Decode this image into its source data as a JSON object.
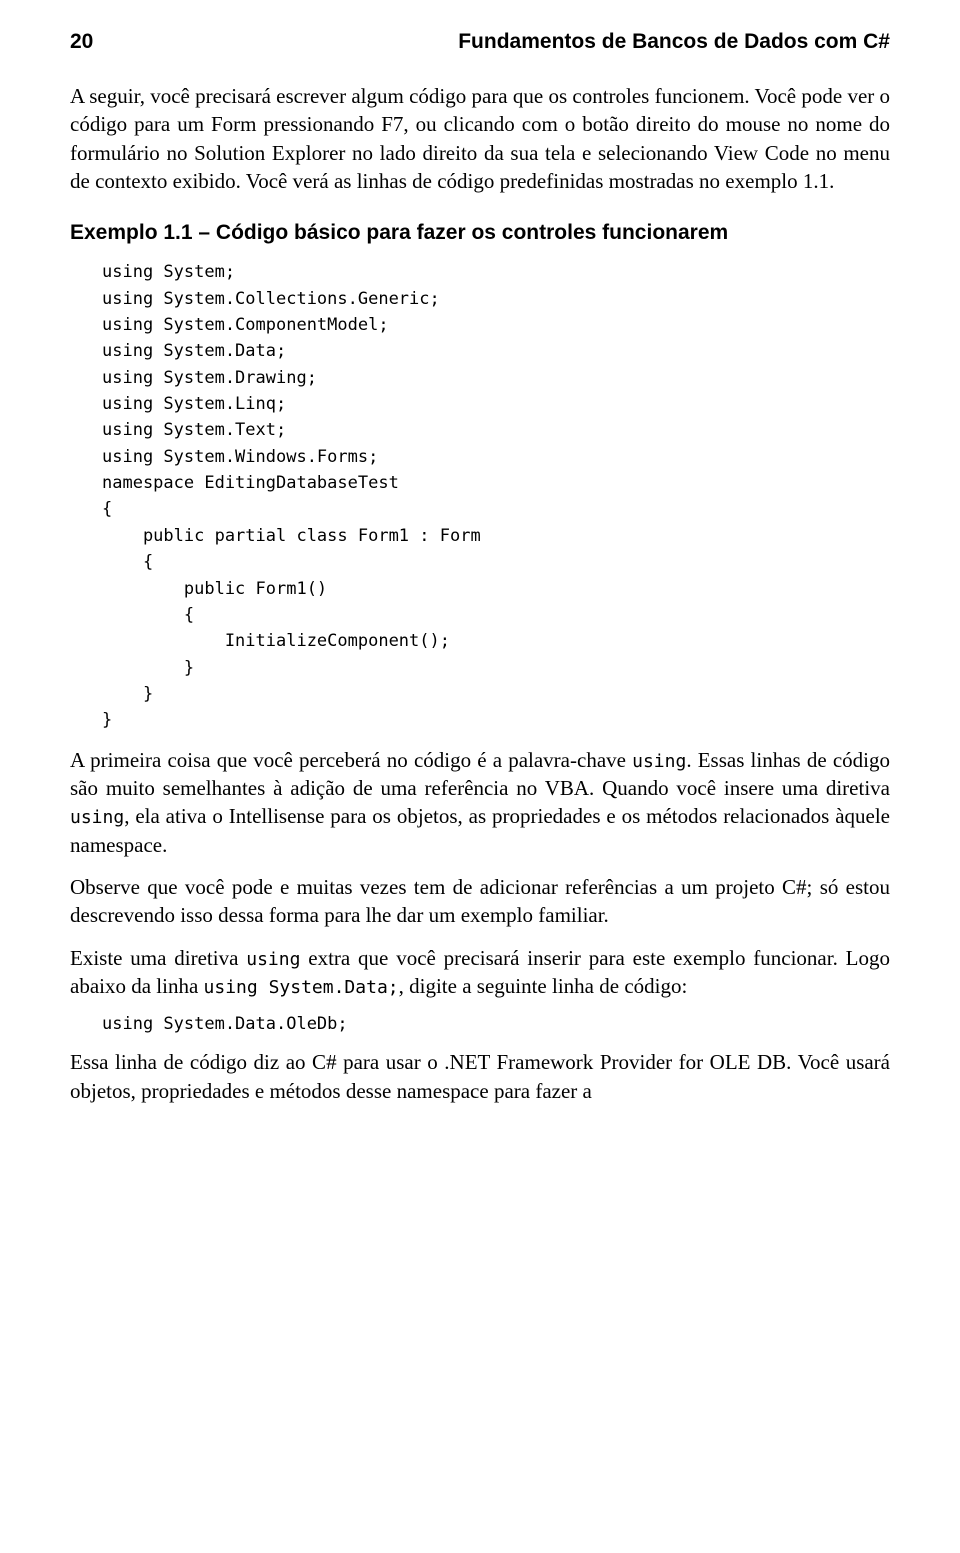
{
  "header": {
    "page_number": "20",
    "book_title": "Fundamentos de Bancos de Dados com C#"
  },
  "paragraphs": {
    "p1": "A seguir, você precisará escrever algum código para que os controles funcionem. Você pode ver o código para um Form pressionando F7, ou clicando com o botão direito do mouse no nome do formulário no Solution Explorer no lado direito da sua tela e selecionando View Code no menu de contexto exibido. Você verá as linhas de código predefinidas mostradas no exemplo 1.1.",
    "example_heading": "Exemplo 1.1 – Código básico para fazer os controles funcionarem",
    "p2_parts": {
      "a": "A primeira coisa que você perceberá no código é a palavra-chave ",
      "b": ". Essas linhas de código são muito semelhantes à adição de uma referência no VBA. Quando você insere uma diretiva ",
      "c": ", ela ativa o Intellisense para os objetos, as propriedades e os métodos relacionados àquele namespace."
    },
    "p3": "Observe que você pode e muitas vezes tem de adicionar referências a um projeto C#; só estou descrevendo isso dessa forma para lhe dar um exemplo familiar.",
    "p4_parts": {
      "a": "Existe uma diretiva ",
      "b": " extra que você precisará inserir para este exemplo funcionar. Logo abaixo da linha ",
      "c": ", digite a seguinte linha de código:"
    },
    "p5": "Essa linha de código diz ao C# para usar o .NET Framework Provider for OLE DB. Você usará objetos, propriedades e métodos desse namespace para fazer a"
  },
  "code": {
    "using_kw": "using",
    "using_system_data": "using System.Data;",
    "oledb_line": "using System.Data.OleDb;",
    "block": "using System;\nusing System.Collections.Generic;\nusing System.ComponentModel;\nusing System.Data;\nusing System.Drawing;\nusing System.Linq;\nusing System.Text;\nusing System.Windows.Forms;\nnamespace EditingDatabaseTest\n{\n    public partial class Form1 : Form\n    {\n        public Form1()\n        {\n            InitializeComponent();\n        }\n    }\n}"
  }
}
